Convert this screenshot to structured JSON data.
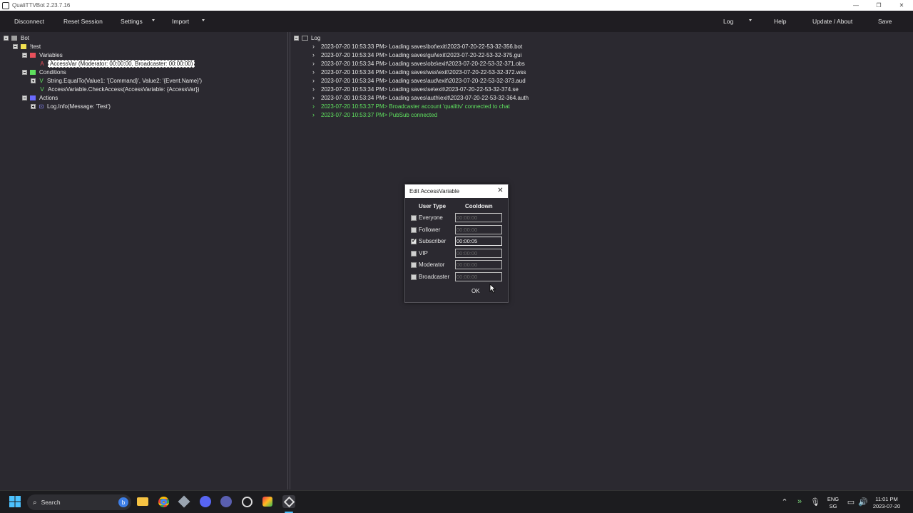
{
  "window": {
    "title": "QualiTTVBot 2.23.7.16",
    "minimize": "—",
    "restore": "❐",
    "close": "✕"
  },
  "menu": {
    "disconnect": "Disconnect",
    "reset_session": "Reset Session",
    "settings": "Settings",
    "import": "Import",
    "log": "Log",
    "help": "Help",
    "update_about": "Update / About",
    "save": "Save"
  },
  "tree": {
    "root": "Bot",
    "command": "!test",
    "variables": "Variables",
    "variable_glyph": "A",
    "variable_item": "AccessVar (Moderator: 00:00:00, Broadcaster: 00:00:00)",
    "conditions": "Conditions",
    "condition_glyph": "V",
    "condition_1": "String.EqualTo(Value1: '{Command}', Value2: '{Event.Name}')",
    "condition_2": "AccessVariable.CheckAccess(AccessVariable: {AccessVar})",
    "actions": "Actions",
    "action_glyph": "⊡",
    "action_1": "Log.Info(Message: 'Test')",
    "colors": {
      "variables": "#e8505b",
      "conditions": "#5ee05e",
      "actions": "#6a6aff",
      "command": "#f0e050",
      "root": "#a0a0a0"
    }
  },
  "log": {
    "header": "Log",
    "entries": [
      {
        "text": "2023-07-20 10:53:33 PM> Loading saves\\bot\\exit\\2023-07-20-22-53-32-356.bot",
        "level": "info"
      },
      {
        "text": "2023-07-20 10:53:34 PM> Loading saves\\gui\\exit\\2023-07-20-22-53-32-375.gui",
        "level": "info"
      },
      {
        "text": "2023-07-20 10:53:34 PM> Loading saves\\obs\\exit\\2023-07-20-22-53-32-371.obs",
        "level": "info"
      },
      {
        "text": "2023-07-20 10:53:34 PM> Loading saves\\wss\\exit\\2023-07-20-22-53-32-372.wss",
        "level": "info"
      },
      {
        "text": "2023-07-20 10:53:34 PM> Loading saves\\aud\\exit\\2023-07-20-22-53-32-373.aud",
        "level": "info"
      },
      {
        "text": "2023-07-20 10:53:34 PM> Loading saves\\se\\exit\\2023-07-20-22-53-32-374.se",
        "level": "info"
      },
      {
        "text": "2023-07-20 10:53:34 PM> Loading saves\\auth\\exit\\2023-07-20-22-53-32-364.auth",
        "level": "info"
      },
      {
        "text": "2023-07-20 10:53:37 PM> Broadcaster account 'qualittv' connected to chat",
        "level": "success"
      },
      {
        "text": "2023-07-20 10:53:37 PM> PubSub connected",
        "level": "success"
      }
    ]
  },
  "dialog": {
    "title": "Edit AccessVariable",
    "col_user_type": "User Type",
    "col_cooldown": "Cooldown",
    "placeholder": "00:00:00",
    "rows": [
      {
        "label": "Everyone",
        "checked": false,
        "value": ""
      },
      {
        "label": "Follower",
        "checked": false,
        "value": ""
      },
      {
        "label": "Subscriber",
        "checked": true,
        "value": "00:00:05"
      },
      {
        "label": "VIP",
        "checked": false,
        "value": ""
      },
      {
        "label": "Moderator",
        "checked": false,
        "value": ""
      },
      {
        "label": "Broadcaster",
        "checked": false,
        "value": ""
      }
    ],
    "ok": "OK"
  },
  "taskbar": {
    "search": "Search",
    "lang_1": "ENG",
    "lang_2": "SG",
    "time": "11:01 PM",
    "date": "2023-07-20"
  }
}
